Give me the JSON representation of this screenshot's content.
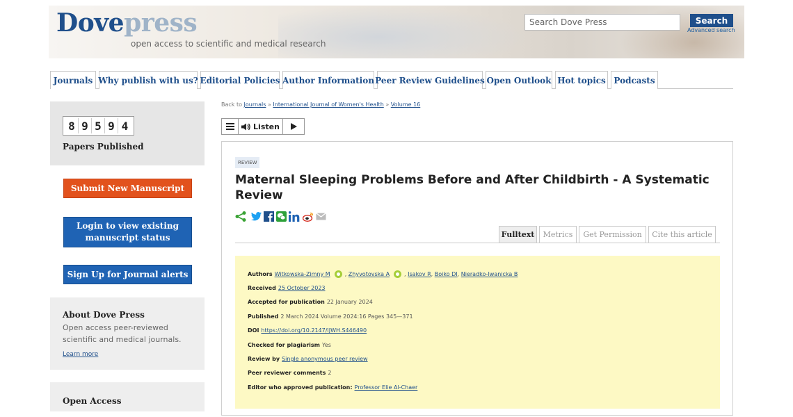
{
  "header": {
    "logo_part1": "Dove",
    "logo_part2": "press",
    "tagline": "open access to scientific and medical research",
    "search_placeholder": "Search Dove Press",
    "search_button": "Search",
    "advanced_search": "Advanced search"
  },
  "nav": {
    "tabs": [
      {
        "label": "Journals"
      },
      {
        "label": "Why publish with us?"
      },
      {
        "label": "Editorial Policies"
      },
      {
        "label": "Author Information"
      },
      {
        "label": "Peer Review Guidelines"
      },
      {
        "label": "Open Outlook"
      },
      {
        "label": "Hot topics"
      },
      {
        "label": "Podcasts"
      }
    ]
  },
  "sidebar": {
    "counter_digits": [
      "8",
      "9",
      "5",
      "9",
      "4"
    ],
    "counter_label": "Papers Published",
    "submit_button": "Submit New Manuscript",
    "login_button": "Login to view existing manuscript status",
    "signup_button": "Sign Up for Journal alerts",
    "about": {
      "title": "About Dove Press",
      "text": "Open access peer-reviewed scientific and medical journals.",
      "link": "Learn more"
    },
    "open_access_title": "Open Access"
  },
  "breadcrumb": {
    "prefix": "Back to",
    "items": [
      "Journals",
      "International Journal of Women's Health",
      "Volume 16"
    ],
    "separator": "»"
  },
  "listen": {
    "label": "Listen"
  },
  "article": {
    "tag": "REVIEW",
    "title": "Maternal Sleeping Problems Before and After Childbirth - A Systematic Review",
    "share_icons": [
      "share-icon",
      "twitter-icon",
      "facebook-icon",
      "wechat-icon",
      "linkedin-icon",
      "weibo-icon",
      "email-icon"
    ],
    "tabs": [
      "Fulltext",
      "Metrics",
      "Get Permission",
      "Cite this article"
    ],
    "active_tab": "Fulltext",
    "meta": {
      "authors_label": "Authors",
      "authors": [
        "Witkowska-Zimny M",
        "Zhyvotovska A",
        "Isakov R",
        "Boiko DI",
        "Nieradko-Iwanicka B"
      ],
      "received_label": "Received",
      "received": "25 October 2023",
      "accepted_label": "Accepted for publication",
      "accepted": "22 January 2024",
      "published_label": "Published",
      "published": "2 March 2024 Volume 2024:16 Pages 345—371",
      "doi_label": "DOI",
      "doi": "https://doi.org/10.2147/IJWH.S446490",
      "plagiarism_label": "Checked for plagiarism",
      "plagiarism": "Yes",
      "review_label": "Review by",
      "review": "Single anonymous peer review",
      "comments_label": "Peer reviewer comments",
      "comments": "2",
      "editor_label": "Editor who approved publication:",
      "editor": "Professor Elie Al-Chaer"
    }
  },
  "colors": {
    "brand_blue": "#1f4f8b",
    "submit_orange": "#e2521d",
    "button_blue": "#1f63b4",
    "meta_bg": "#fdf9c4",
    "orcid_green": "#a6ce39"
  }
}
